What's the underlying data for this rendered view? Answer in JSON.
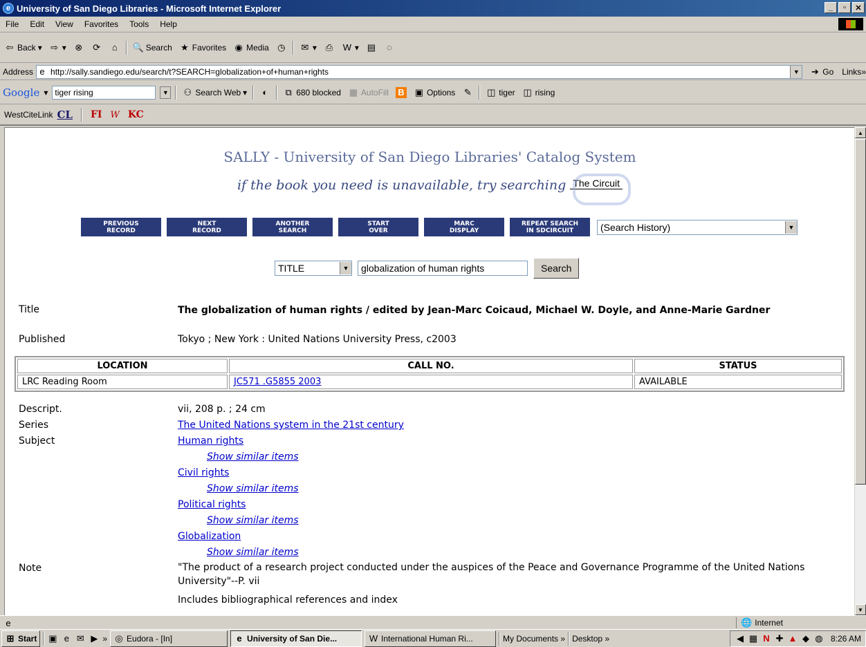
{
  "window": {
    "title": "University of San Diego Libraries - Microsoft Internet Explorer"
  },
  "menu": [
    "File",
    "Edit",
    "View",
    "Favorites",
    "Tools",
    "Help"
  ],
  "toolbar": {
    "back": "Back",
    "search": "Search",
    "favorites": "Favorites",
    "media": "Media"
  },
  "address": {
    "label": "Address",
    "url": "http://sally.sandiego.edu/search/t?SEARCH=globalization+of+human+rights",
    "go": "Go",
    "links": "Links"
  },
  "google": {
    "label": "Google",
    "query": "tiger rising",
    "search_web": "Search Web",
    "blocked": "680 blocked",
    "autofill": "AutoFill",
    "options": "Options",
    "term1": "tiger",
    "term2": "rising"
  },
  "westcite": {
    "label": "WestCiteLink",
    "cl": "CL",
    "fi": "FI",
    "kc": "KC"
  },
  "page": {
    "header_title": "SALLY - University of San Diego Libraries' Catalog System",
    "tagline": "if the book you need is unavailable, try searching",
    "circuit": "The Circuit",
    "nav_buttons": [
      {
        "line1": "Previous",
        "line2": "Record"
      },
      {
        "line1": "Next",
        "line2": "Record"
      },
      {
        "line1": "Another",
        "line2": "Search"
      },
      {
        "line1": "Start",
        "line2": "Over"
      },
      {
        "line1": "MARC",
        "line2": "Display"
      },
      {
        "line1": "Repeat Search",
        "line2": "in SDCircuit"
      }
    ],
    "history_select": "(Search History)",
    "search_type": "TITLE",
    "search_value": "globalization of human rights",
    "search_button": "Search"
  },
  "record": {
    "title_label": "Title",
    "title_value": "The globalization of human rights / edited by Jean-Marc Coicaud, Michael W. Doyle, and Anne-Marie Gardner",
    "published_label": "Published",
    "published_value": "Tokyo ; New York : United Nations University Press, c2003",
    "holdings": {
      "headers": [
        "LOCATION",
        "CALL NO.",
        "STATUS"
      ],
      "location": "LRC Reading Room",
      "call_no": "JC571 .G5855 2003",
      "status": "AVAILABLE"
    },
    "descript_label": "Descript.",
    "descript_value": "vii, 208 p. ; 24 cm",
    "series_label": "Series",
    "series_value": "The United Nations system in the 21st century",
    "subject_label": "Subject",
    "subjects": [
      "Human rights",
      "Civil rights",
      "Political rights",
      "Globalization"
    ],
    "similar": "Show similar items",
    "note_label": "Note",
    "note_value": "\"The product of a research project conducted under the auspices of the Peace and Governance Programme of the United Nations University\"--P. vii",
    "note2_value": "Includes bibliographical references and index"
  },
  "status": {
    "zone": "Internet"
  },
  "taskbar": {
    "start": "Start",
    "tasks": [
      "Eudora - [In]",
      "University of San Die...",
      "International Human Ri..."
    ],
    "my_documents": "My Documents",
    "desktop": "Desktop",
    "clock": "8:26 AM"
  },
  "colors": {
    "title_bar": "#0a246a",
    "nav_button": "#2a3a78",
    "link": "#0000cc",
    "header_text": "#5a6a99"
  }
}
